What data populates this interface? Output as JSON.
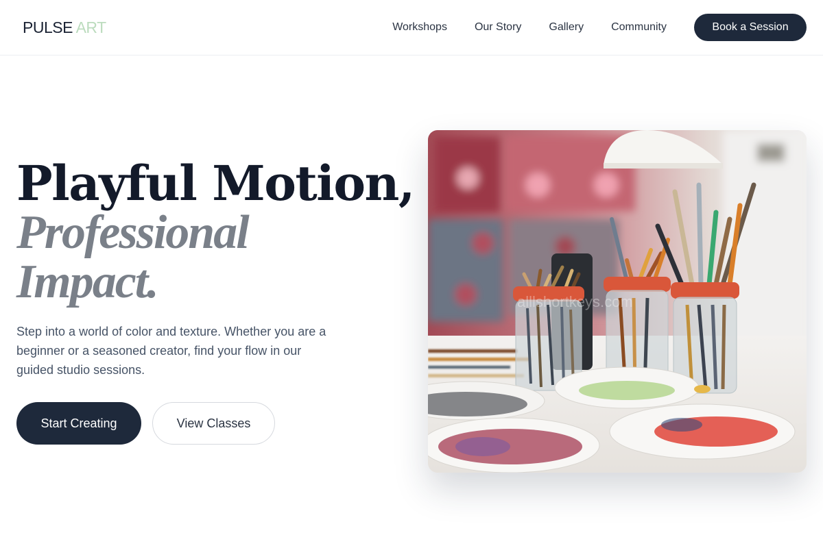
{
  "brand": {
    "word1": "PULSE",
    "word2": "ART"
  },
  "nav": {
    "items": [
      {
        "label": "Workshops"
      },
      {
        "label": "Our Story"
      },
      {
        "label": "Gallery"
      },
      {
        "label": "Community"
      }
    ],
    "cta_label": "Book a Session"
  },
  "hero": {
    "headline_line1": "Playful Motion,",
    "headline_line2": "Professional",
    "headline_line3": "Impact.",
    "description": "Step into a world of color and texture. Whether you are a beginner or a seasoned creator, find your flow in our guided studio sessions.",
    "primary_button": "Start Creating",
    "secondary_button": "View Classes",
    "image_watermark": "alllshortkeys.com"
  },
  "colors": {
    "primary": "#1e293b",
    "accent_green": "#bcdcbe",
    "muted_headline": "#7a8089",
    "body_text": "#465366"
  },
  "icons": []
}
